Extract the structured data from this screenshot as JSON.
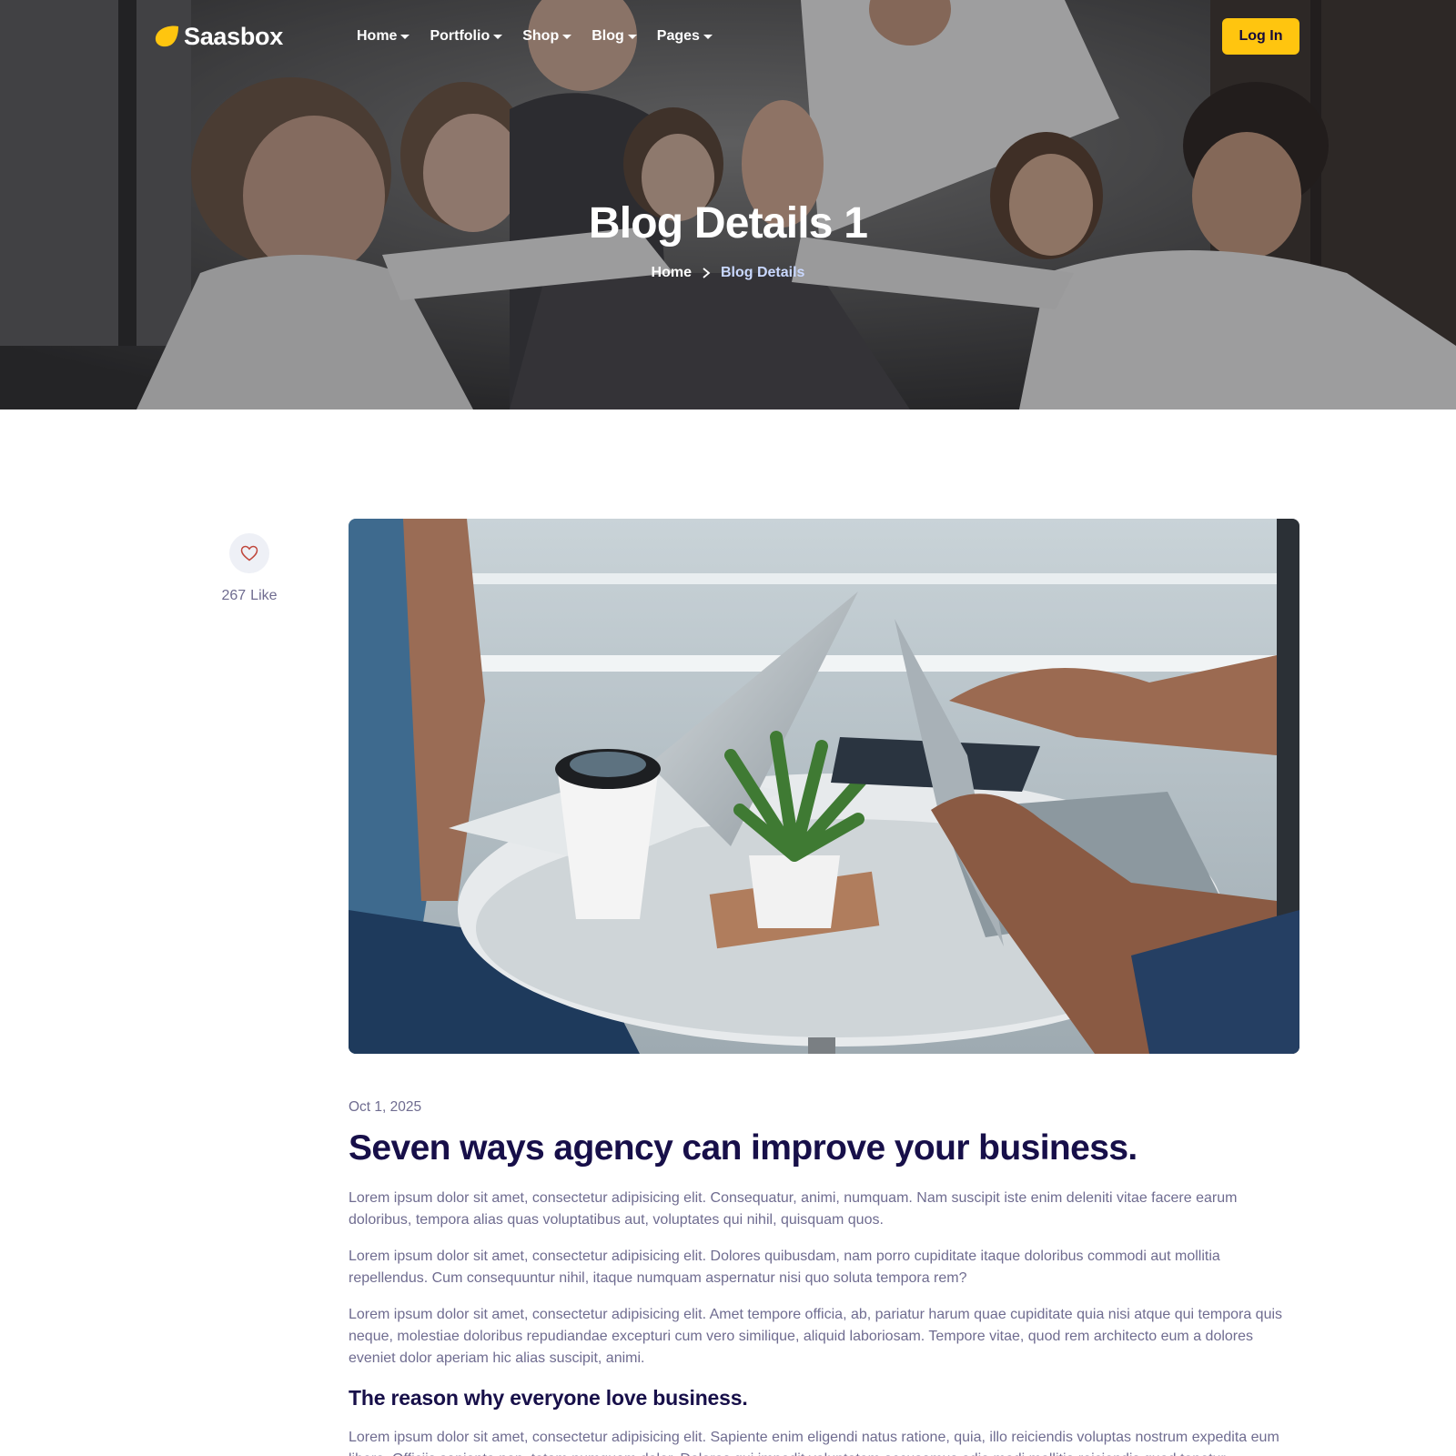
{
  "brand": {
    "name": "Saasbox",
    "accent": "#ffc50f",
    "heading_color": "#170f49",
    "text_color": "#6f6c90"
  },
  "nav": {
    "items": [
      {
        "label": "Home"
      },
      {
        "label": "Portfolio"
      },
      {
        "label": "Shop"
      },
      {
        "label": "Blog"
      },
      {
        "label": "Pages"
      }
    ],
    "login_label": "Log In"
  },
  "hero": {
    "title": "Blog Details 1",
    "breadcrumb": {
      "home": "Home",
      "current": "Blog Details"
    }
  },
  "like": {
    "count": "267",
    "label": "Like",
    "icon": "heart-icon"
  },
  "article": {
    "date": "Oct 1, 2025",
    "title": "Seven ways agency can improve your business.",
    "paragraphs": [
      "Lorem ipsum dolor sit amet, consectetur adipisicing elit. Consequatur, animi, numquam. Nam suscipit iste enim deleniti vitae facere earum doloribus, tempora alias quas voluptatibus aut, voluptates qui nihil, quisquam quos.",
      "Lorem ipsum dolor sit amet, consectetur adipisicing elit. Dolores quibusdam, nam porro cupiditate itaque doloribus commodi aut mollitia repellendus. Cum consequuntur nihil, itaque numquam aspernatur nisi quo soluta tempora rem?",
      "Lorem ipsum dolor sit amet, consectetur adipisicing elit. Amet tempore officia, ab, pariatur harum quae cupiditate quia nisi atque qui tempora quis neque, molestiae doloribus repudiandae excepturi cum vero similique, aliquid laboriosam. Tempore vitae, quod rem architecto eum a dolores eveniet dolor aperiam hic alias suscipit, animi."
    ],
    "subheading": "The reason why everyone love business.",
    "last_paragraph": "Lorem ipsum dolor sit amet, consectetur adipisicing elit. Sapiente enim eligendi natus ratione, quia, illo reiciendis voluptas nostrum expedita eum libero. Officiis sapiente non, totam numquam dolor. Dolores qui impedit voluptatem accusamus odio modi mollitia reiciendis quod tenetur."
  }
}
